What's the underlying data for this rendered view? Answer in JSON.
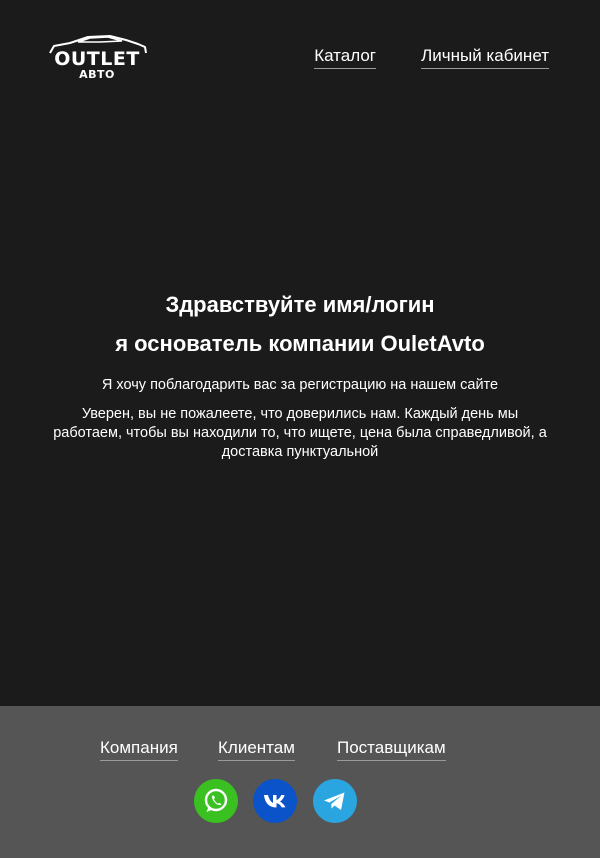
{
  "header": {
    "logo": {
      "main": "OUTLET",
      "sub": "АВТО"
    },
    "nav": {
      "catalog": "Каталог",
      "account": "Личный кабинет"
    }
  },
  "hero": {
    "title_line1": "Здравствуйте имя/логин",
    "title_line2": "я основатель компании OuletAvto",
    "thanks": "Я хочу поблагодарить вас за регистрацию на нашем сайте",
    "message": "Уверен, вы не пожалеете, что доверились нам. Каждый день мы работаем, чтобы вы находили то, что ищете, цена была справедливой, а доставка пунктуальной"
  },
  "footer": {
    "links": {
      "company": "Компания",
      "clients": "Клиентам",
      "suppliers": "Поставщикам"
    },
    "social": [
      {
        "icon": "whatsapp-icon",
        "color": "#3ac121"
      },
      {
        "icon": "vk-icon",
        "color": "#0a53c9"
      },
      {
        "icon": "telegram-icon",
        "color": "#2ba5e0"
      }
    ]
  },
  "colors": {
    "background": "#1c1b1c",
    "footer_background": "#555555",
    "text": "#ffffff"
  }
}
